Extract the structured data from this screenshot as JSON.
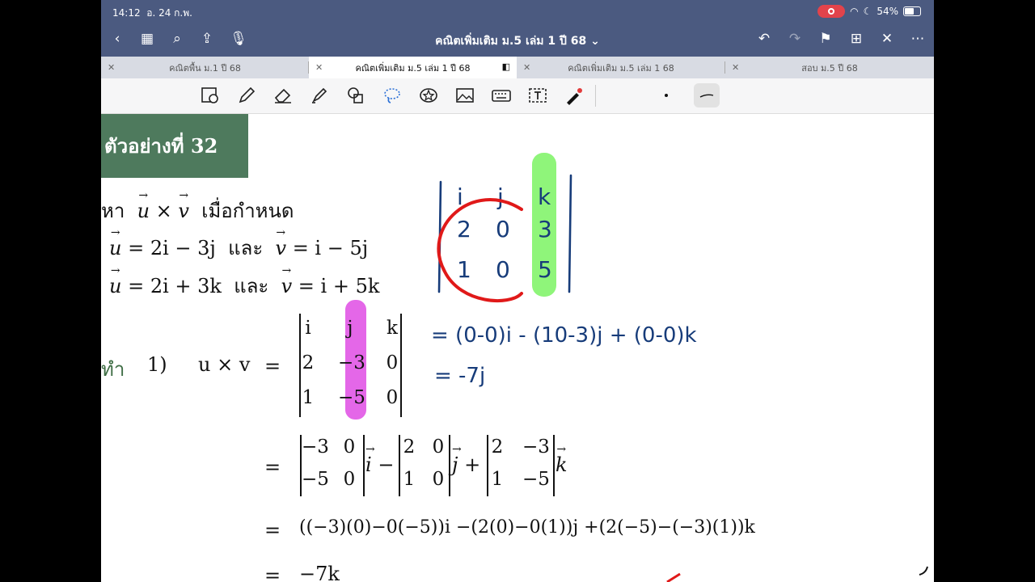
{
  "status": {
    "time": "14:12",
    "date": "อ. 24 ก.พ.",
    "battery": "54%"
  },
  "nav": {
    "title": "คณิตเพิ่มเติม ม.5 เล่ม 1 ปี 68",
    "left_icons": [
      "back-icon",
      "grid-icon",
      "search-icon",
      "share-icon",
      "mic-icon"
    ],
    "right_icons": [
      "undo-icon",
      "redo-icon",
      "bookmark-icon",
      "add-page-icon",
      "close-edit-icon",
      "more-icon"
    ]
  },
  "tabs": [
    {
      "label": "คณิตพื้น ม.1 ปี 68",
      "active": false
    },
    {
      "label": "คณิตเพิ่มเติม ม.5 เล่ม 1 ปี 68",
      "active": true
    },
    {
      "label": "คณิตเพิ่มเติม ม.5 เล่ม 1 68",
      "active": false
    },
    {
      "label": "สอบ ม.5 ปี 68",
      "active": false
    }
  ],
  "toolbar": [
    "zoom-icon",
    "pen-icon",
    "eraser-icon",
    "highlighter-icon",
    "shapes-icon",
    "lasso-icon",
    "sticker-icon",
    "image-icon",
    "keyboard-icon",
    "text-icon",
    "laser-icon",
    "dot-size-icon",
    "stroke-style-icon"
  ],
  "content": {
    "banner": "ตัวอย่างที่ 32",
    "find_prefix": "หา",
    "find_suffix": "เมื่อกำหนด",
    "cond1_u": "= 2i − 3j",
    "and": "และ",
    "cond1_v": "= i − 5j",
    "cond2_u": "= 2i + 3k",
    "cond2_v": "= i + 5k",
    "solution": "ทำ",
    "part": "1)",
    "uxv": "u × v",
    "eq": "=",
    "det_main": [
      "i",
      "j",
      "k",
      "2",
      "−3",
      "0",
      "1",
      "−5",
      "0"
    ],
    "step1_minors": [
      [
        "−3",
        "0",
        "−5",
        "0"
      ],
      [
        "2",
        "0",
        "1",
        "0"
      ],
      [
        "2",
        "−3",
        "1",
        "−5"
      ]
    ],
    "step2": "((−3)(0)−0(−5))i −(2(0)−0(1))j +(2(−5)−(−3)(1))k",
    "result": "−7k"
  },
  "handwriting": {
    "det_cells": [
      "i",
      "j",
      "k",
      "2",
      "0",
      "3",
      "1",
      "0",
      "5"
    ],
    "line1": "= (0-0)i - (10-3)j + (0-0)k",
    "line2": "= -7j"
  },
  "colors": {
    "topbar": "#4b5a80",
    "banner": "#4e7a5d",
    "pink": "#e467e8",
    "green": "#8ff57a",
    "ink": "#173c7a",
    "red": "#e01919"
  }
}
